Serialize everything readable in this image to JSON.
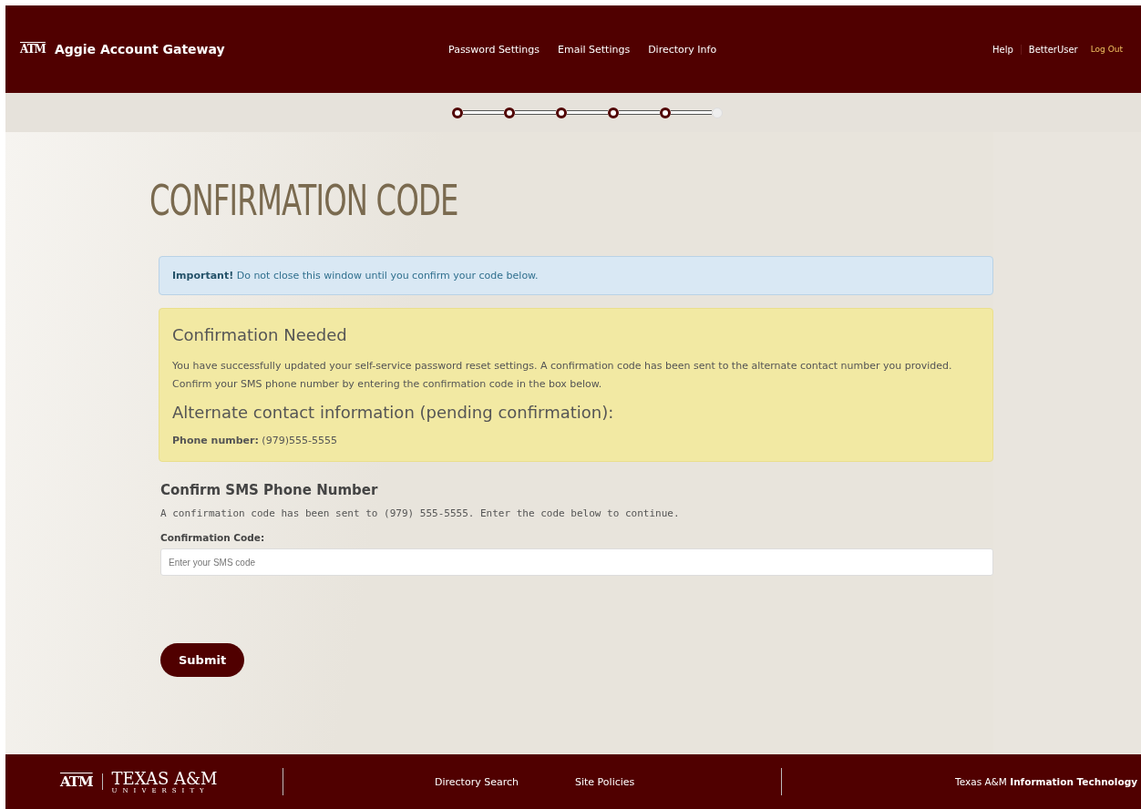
{
  "header": {
    "logo_mark": "ATM",
    "title": "Aggie Account Gateway",
    "nav": [
      "Password Settings",
      "Email Settings",
      "Directory Info"
    ],
    "help": "Help",
    "user": "BetterUser",
    "logout": "Log Out"
  },
  "progress": {
    "steps": [
      {
        "done": true
      },
      {
        "done": true
      },
      {
        "done": true
      },
      {
        "done": true
      },
      {
        "done": true
      },
      {
        "done": false
      }
    ]
  },
  "page_title": "CONFIRMATION CODE",
  "info_alert": "**Important!** Do not close this window until you confirm your code below.",
  "warning": {
    "heading": "Confirmation Needed",
    "text": "You have successfully updated your self-service password reset settings. A confirmation code has been sent to the alternate contact number you provided. Confirm your SMS phone number by entering the confirmation code in the box below.",
    "subheading": "Alternate contact information (pending confirmation):",
    "phone": "**Phone number:** (979)555-5555"
  },
  "confirm": {
    "heading": "Confirm SMS Phone Number",
    "text": "A confirmation code has been sent to (979) 555-5555. Enter the code below to continue.",
    "label": "Confirmation Code:",
    "placeholder": "Enter your SMS code",
    "button": "Submit"
  },
  "footer": {
    "logo_mark": "ATM",
    "wordmark": "TEXAS A&M",
    "wordmark_sub": "UNIVERSITY",
    "links": [
      "Directory Search",
      "Site Policies"
    ],
    "credit": "Texas A&M **Information Technology**"
  }
}
